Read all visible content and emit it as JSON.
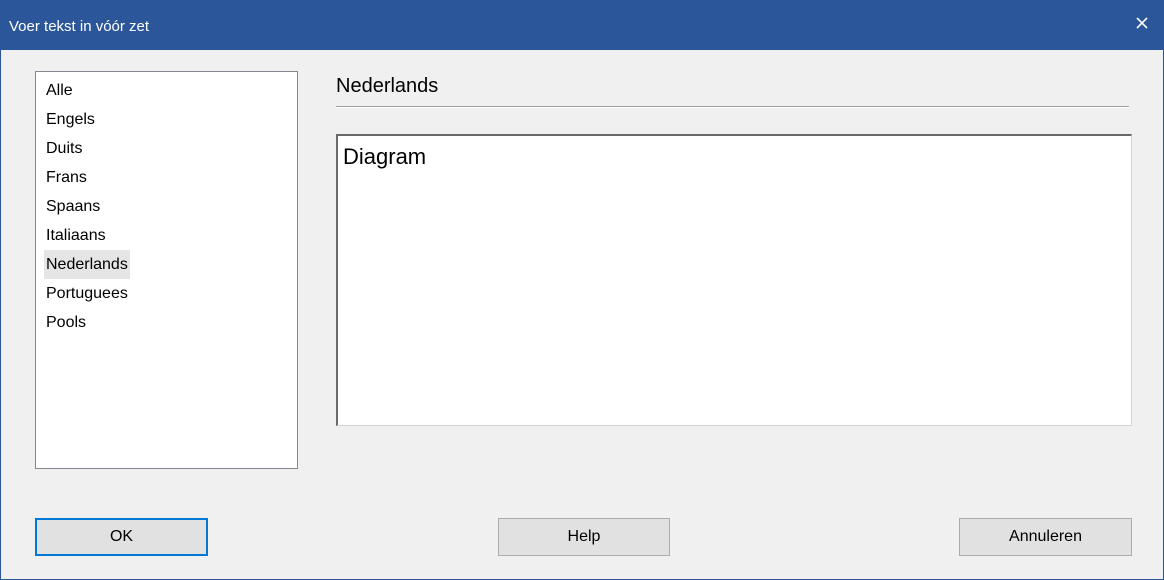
{
  "window": {
    "title": "Voer tekst in vóór zet",
    "close_icon": "close-icon",
    "title_bar_color": "#2b579a"
  },
  "language_list": {
    "items": [
      {
        "label": "Alle",
        "selected": false
      },
      {
        "label": "Engels",
        "selected": false
      },
      {
        "label": "Duits",
        "selected": false
      },
      {
        "label": "Frans",
        "selected": false
      },
      {
        "label": "Spaans",
        "selected": false
      },
      {
        "label": "Italiaans",
        "selected": false
      },
      {
        "label": "Nederlands",
        "selected": true
      },
      {
        "label": "Portuguees",
        "selected": false
      },
      {
        "label": "Pools",
        "selected": false
      }
    ]
  },
  "editor": {
    "heading": "Nederlands",
    "text": "Diagram"
  },
  "buttons": {
    "ok": "OK",
    "help": "Help",
    "cancel": "Annuleren"
  }
}
